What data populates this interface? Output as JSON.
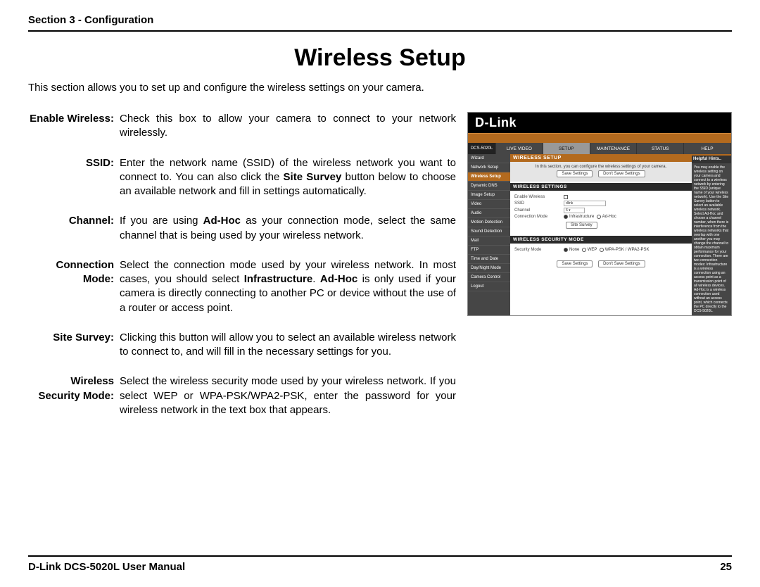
{
  "header": {
    "section": "Section 3 - Configuration"
  },
  "title": "Wireless Setup",
  "intro": "This section allows you to set up and configure the wireless settings on your camera.",
  "defs": [
    {
      "term": "Enable Wireless:",
      "desc": "Check this box to allow your camera to connect to your network wirelessly."
    },
    {
      "term": "SSID:",
      "desc": "Enter the network name (SSID) of the wireless network you want to connect to. You can also click the <b>Site Survey</b> button below to choose an available network and fill in settings automatically."
    },
    {
      "term": "Channel:",
      "desc": "If you are using <b>Ad-Hoc</b> as your connection mode, select the same channel that is being used by your wireless network."
    },
    {
      "term": "Connection Mode:",
      "desc": "Select the connection mode used by your wireless network. In most cases, you should select <b>Infrastructure</b>. <b>Ad-Hoc</b> is only used if your camera is directly connecting to another PC or device without the use of a router or access point."
    },
    {
      "term": "Site Survey:",
      "desc": "Clicking this button will allow you to select an available wireless network to connect to, and will fill in the necessary settings for you."
    },
    {
      "term": "Wireless Security Mode:",
      "desc": "Select the wireless security mode used by your wireless network. If you select WEP or WPA-PSK/WPA2-PSK, enter the password for your wireless network in the text box that appears."
    }
  ],
  "screenshot": {
    "brand": "D-Link",
    "model": "DCS-5020L",
    "tabs": [
      "LIVE VIDEO",
      "SETUP",
      "MAINTENANCE",
      "STATUS",
      "HELP"
    ],
    "active_tab": "SETUP",
    "sidebar": [
      "Wizard",
      "Network Setup",
      "Wireless Setup",
      "Dynamic DNS",
      "Image Setup",
      "Video",
      "Audio",
      "Motion Detection",
      "Sound Detection",
      "Mail",
      "FTP",
      "Time and Date",
      "Day/Night Mode",
      "Camera Control",
      "Logout"
    ],
    "sidebar_selected": "Wireless Setup",
    "section_title": "WIRELESS SETUP",
    "section_desc": "In this section, you can configure the wireless settings of your camera.",
    "btn_save": "Save Settings",
    "btn_dont": "Don't Save Settings",
    "panel1_title": "WIRELESS SETTINGS",
    "rows": {
      "enable": "Enable Wireless",
      "ssid": "SSID",
      "ssid_val": "dlink",
      "channel": "Channel",
      "channel_val": "6 ▾",
      "connmode": "Connection Mode",
      "infra": "Infrastructure",
      "adhoc": "Ad-Hoc",
      "survey": "Site Survey"
    },
    "panel2_title": "WIRELESS SECURITY MODE",
    "secrow": {
      "label": "Security Mode",
      "none": "None",
      "wep": "WEP",
      "wpa": "WPA-PSK / WPA2-PSK"
    },
    "hints_title": "Helpful Hints..",
    "hints_body": "You may enable the wireless setting on your camera and connect to a wireless network by entering the SSID (unique name of your wireless network). Use the Site Survey button to select an available wireless network. Select Ad-Hoc and choose a channel number, when there is interference from the wireless networks that overlap with one another you may change the channel to obtain maximum performance for your connection. There are two connection modes: Infrastructure is a wireless connection using an access point as a transmission point of all wireless devices. Ad-Hoc is a wireless connection used without an access point, which connects the PC directly to the DCS-5020L."
  },
  "footer": {
    "left": "D-Link DCS-5020L User Manual",
    "right": "25"
  }
}
